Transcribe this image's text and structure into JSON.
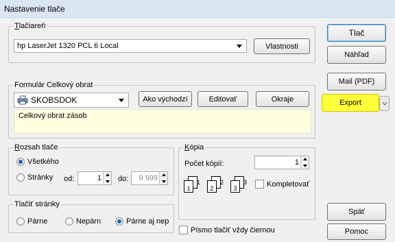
{
  "window": {
    "title": "Nastavenie tlače"
  },
  "printer": {
    "legend_accel": "T",
    "legend_rest": "lačiareň",
    "selected": "hp LaserJet 1320 PCL 6 Local",
    "properties_button": "Vlastnosti"
  },
  "form": {
    "legend": "Formulár Celkový obrat",
    "selected": "SKOBSDOK",
    "default_button": "Ako východzí",
    "edit_button": "Editovať",
    "margins_button": "Okraje",
    "description": "Celkový obrat zásob"
  },
  "range": {
    "legend_accel": "R",
    "legend_rest": "ozsah tlače",
    "all_label": "Všetkého",
    "pages_label": "Stránky",
    "from_label": "od:",
    "from_value": "1",
    "to_label": "do:",
    "to_value": "9 999"
  },
  "copies": {
    "legend_accel": "K",
    "legend_rest": "ópia",
    "count_label": "Počet kópií:",
    "count_value": "1",
    "collate_label": "Kompletovať",
    "pages": [
      "1",
      "2",
      "3",
      "1",
      "2",
      "3"
    ]
  },
  "print_pages": {
    "legend": "Tlačiť stránky",
    "odd_label": "Párne",
    "even_label": "Nepárn",
    "both_label": "Párne aj nep"
  },
  "black_only_label": "Písmo tlačiť vždy čiernou",
  "side_buttons": {
    "print": "Tlač",
    "preview": "Náhľad",
    "mail": "Mail (PDF)",
    "export": "Export",
    "back": "Späť",
    "help": "Pomoc"
  },
  "colors": {
    "export_highlight": "#ffff3a",
    "primary_border": "#3c7fb1"
  }
}
